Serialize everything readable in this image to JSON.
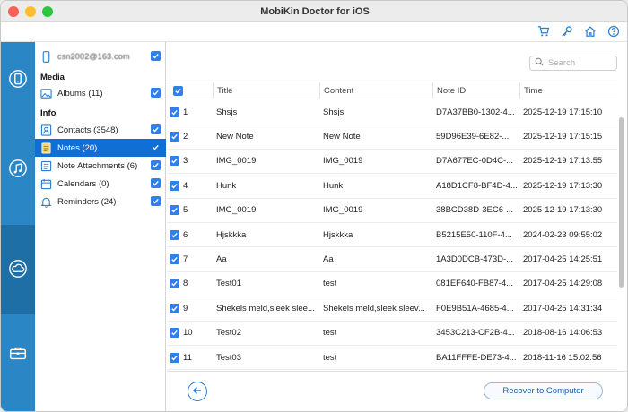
{
  "window": {
    "title": "MobiKin Doctor for iOS"
  },
  "toolbar": {
    "icons": [
      "cart-icon",
      "key-icon",
      "home-icon",
      "help-icon"
    ]
  },
  "leftbar": {
    "items": [
      "device-recover-icon",
      "itunes-backup-icon",
      "icloud-icon",
      "toolkit-icon"
    ],
    "active": "icloud-icon"
  },
  "account": {
    "label": "csn2002@163.com"
  },
  "categories": {
    "media_header": "Media",
    "info_header": "Info",
    "items": [
      {
        "label": "Albums (11)",
        "icon": "photo-icon"
      },
      {
        "label": "Contacts (3548)",
        "icon": "contacts-icon"
      },
      {
        "label": "Notes (20)",
        "icon": "notes-icon",
        "selected": true
      },
      {
        "label": "Note Attachments (6)",
        "icon": "attachment-icon"
      },
      {
        "label": "Calendars (0)",
        "icon": "calendar-icon"
      },
      {
        "label": "Reminders (24)",
        "icon": "bell-icon"
      }
    ]
  },
  "search": {
    "placeholder": "Search"
  },
  "table": {
    "columns": [
      "Title",
      "Content",
      "Note ID",
      "Time"
    ],
    "rows": [
      {
        "num": "1",
        "title": "Shsjs",
        "content": "Shsjs",
        "note_id": "D7A37BB0-1302-4...",
        "time": "2025-12-19 17:15:10"
      },
      {
        "num": "2",
        "title": "New Note",
        "content": "New Note",
        "note_id": "59D96E39-6E82-...",
        "time": "2025-12-19 17:15:15"
      },
      {
        "num": "3",
        "title": "IMG_0019",
        "content": "IMG_0019",
        "note_id": "D7A677EC-0D4C-...",
        "time": "2025-12-19 17:13:55"
      },
      {
        "num": "4",
        "title": "Hunk",
        "content": "Hunk",
        "note_id": "A18D1CF8-BF4D-4...",
        "time": "2025-12-19 17:13:30"
      },
      {
        "num": "5",
        "title": "IMG_0019",
        "content": "IMG_0019",
        "note_id": "38BCD38D-3EC6-...",
        "time": "2025-12-19 17:13:30"
      },
      {
        "num": "6",
        "title": "Hjskkka",
        "content": "Hjskkka",
        "note_id": "B5215E50-110F-4...",
        "time": "2024-02-23 09:55:02"
      },
      {
        "num": "7",
        "title": "Aa",
        "content": "Aa",
        "note_id": "1A3D0DCB-473D-...",
        "time": "2017-04-25 14:25:51"
      },
      {
        "num": "8",
        "title": "Test01",
        "content": "test",
        "note_id": "081EF640-FB87-4...",
        "time": "2017-04-25 14:29:08"
      },
      {
        "num": "9",
        "title": "Shekels meld,sleek slee...",
        "content": "Shekels meld,sleek sleev...",
        "note_id": "F0E9B51A-4685-4...",
        "time": "2017-04-25 14:31:34"
      },
      {
        "num": "10",
        "title": "Test02",
        "content": "test",
        "note_id": "3453C213-CF2B-4...",
        "time": "2018-08-16 14:06:53"
      },
      {
        "num": "11",
        "title": "Test03",
        "content": "test",
        "note_id": "BA11FFFE-DE73-4...",
        "time": "2018-11-16 15:02:56"
      }
    ]
  },
  "footer": {
    "recover_label": "Recover to Computer"
  },
  "colors": {
    "accent": "#2b86c5",
    "selection": "#0f6fd6",
    "checkbox": "#2f80ed"
  }
}
